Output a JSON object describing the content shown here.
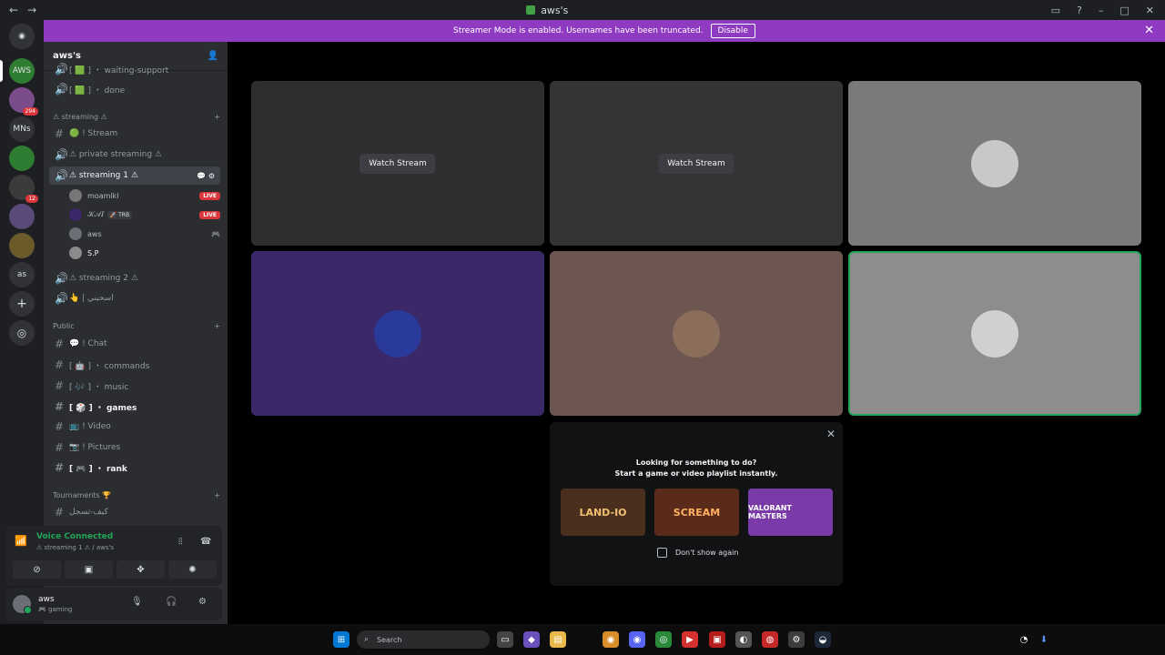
{
  "window": {
    "title": "aws's"
  },
  "banner": {
    "text": "Streamer Mode is enabled. Usernames have been truncated.",
    "button": "Disable"
  },
  "servers": [
    {
      "label": "AWS",
      "badge": ""
    },
    {
      "label": "",
      "badge": "294"
    },
    {
      "label": "MNs",
      "badge": ""
    },
    {
      "label": "",
      "badge": ""
    },
    {
      "label": "",
      "badge": "12"
    },
    {
      "label": "",
      "badge": ""
    },
    {
      "label": "",
      "badge": ""
    },
    {
      "label": "as",
      "badge": ""
    }
  ],
  "sidebar": {
    "server_name": "aws's",
    "channels_top": [
      {
        "label": "[ 🟩 ] ・ waiting-support"
      },
      {
        "label": "[ 🟩 ] ・ done"
      }
    ],
    "cat_streaming": "⚠ streaming ⚠",
    "streaming_channels": [
      {
        "label": "🟢 ! Stream"
      },
      {
        "label": "⚠ private streaming ⚠"
      },
      {
        "label": "⚠ streaming 1 ⚠"
      }
    ],
    "voice_users": [
      {
        "name": "moamlkl",
        "tag": "",
        "live": "LIVE"
      },
      {
        "name": "𝒦𝒜𝐼",
        "tag": "🚀 TRB",
        "live": "LIVE"
      },
      {
        "name": "aws",
        "tag": "",
        "live": ""
      },
      {
        "name": "S.P",
        "tag": "",
        "live": ""
      }
    ],
    "streaming_more": [
      {
        "label": "⚠ streaming 2 ⚠"
      },
      {
        "label": "👆 | اسحبني"
      }
    ],
    "cat_public": "Public",
    "public_channels": [
      {
        "label": "💬 ! Chat"
      },
      {
        "label": "[ 🤖 ] ・ commands"
      },
      {
        "label": "[ 🎶 ] ・ music"
      },
      {
        "label": "[ 🎲 ] ・ games"
      },
      {
        "label": "📺 ! Video"
      },
      {
        "label": "📷 ! Pictures"
      },
      {
        "label": "[ 🎮 ] ・ rank"
      }
    ],
    "cat_tournaments": "Tournaments 🏆",
    "tournament_channels": [
      {
        "label": "كيف-تسجل"
      }
    ]
  },
  "voice": {
    "status": "Voice Connected",
    "channel": "⚠ streaming 1 ⚠ / aws's"
  },
  "user": {
    "name": "aws",
    "status": "🎮 gaming"
  },
  "stage": {
    "watch_label": "Watch Stream",
    "tile_colors": [
      "#2e2e2e",
      "#343434",
      "#7a7a7a",
      "#3a2868",
      "#6e5650",
      "#8d8d8d"
    ],
    "tile_watch": [
      true,
      true,
      false,
      false,
      false,
      false
    ]
  },
  "activity": {
    "line1": "Looking for something to do?",
    "line2": "Start a game or video playlist instantly.",
    "cards": [
      "LAND-IO",
      "SCREAM",
      "VALORANT MASTERS"
    ],
    "checkbox_label": "Don't show again"
  },
  "taskbar": {
    "search_placeholder": "Search"
  }
}
